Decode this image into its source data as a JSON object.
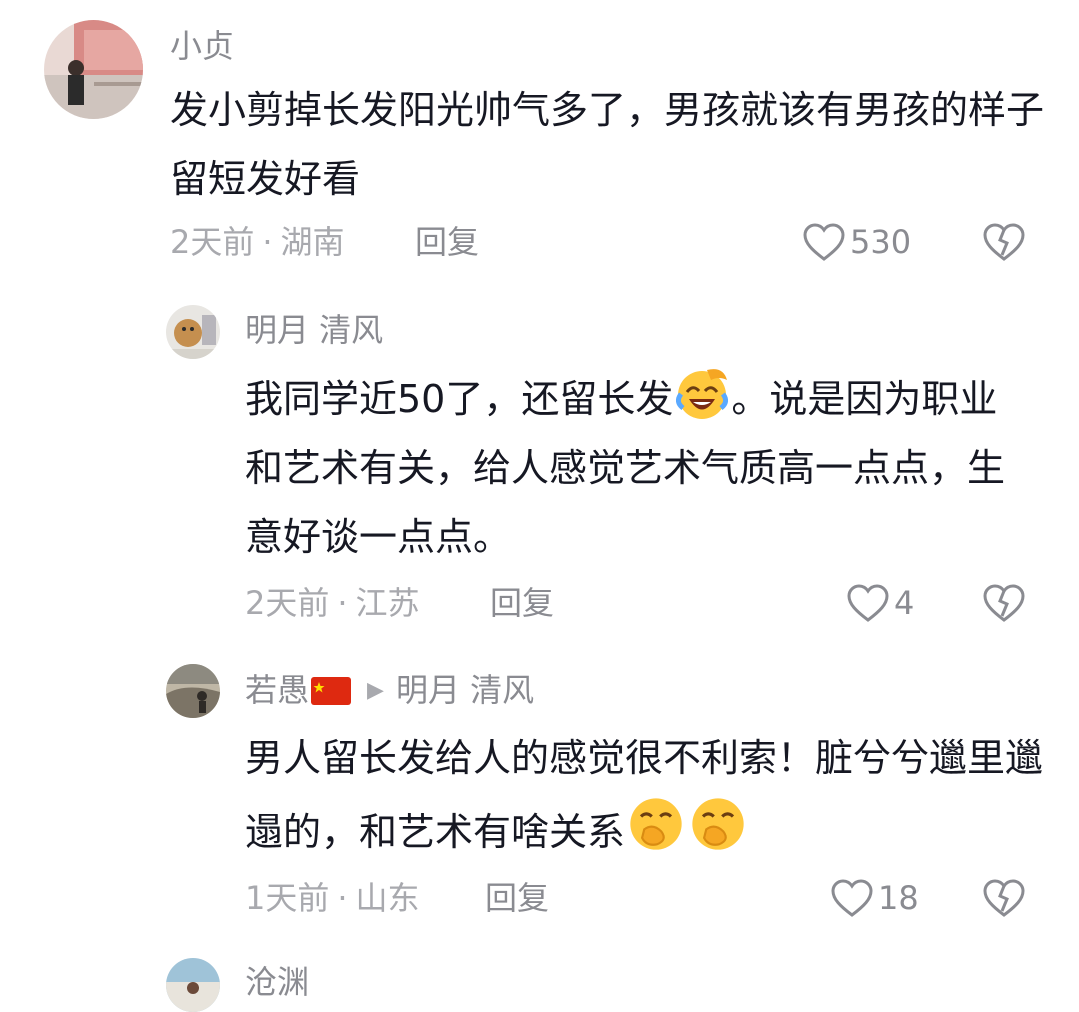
{
  "comments": [
    {
      "username": "小贞",
      "text": "发小剪掉长发阳光帅气多了，男孩就该有男孩的样子留短发好看",
      "time": "2天前",
      "location": "湖南",
      "reply_label": "回复",
      "likes": "530"
    },
    {
      "username": "明月 清风",
      "text_before_emoji": "我同学近50了，还留长发",
      "text_after_emoji": "。说是因为职业和艺术有关，给人感觉艺术气质高一点点，生意好谈一点点。",
      "emoji": "laughing-crying-emoji",
      "time": "2天前",
      "location": "江苏",
      "reply_label": "回复",
      "likes": "4"
    },
    {
      "username": "若愚",
      "reply_to": "明月 清风",
      "text": "男人留长发给人的感觉很不利索！脏兮兮邋里邋遢的，和艺术有啥关系",
      "emoji": "hand-over-mouth-emoji",
      "time": "1天前",
      "location": "山东",
      "reply_label": "回复",
      "likes": "18"
    },
    {
      "username": "沧渊"
    }
  ],
  "meta_separator": "·",
  "colors": {
    "text": "#161823",
    "secondary": "#8a8b91",
    "muted": "#a8a9ae"
  }
}
